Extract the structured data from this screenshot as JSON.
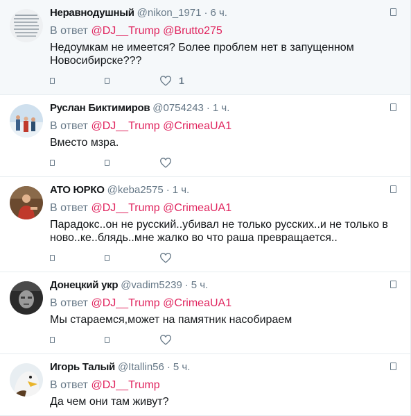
{
  "colors": {
    "mention": "#e0245e",
    "secondary": "#657786",
    "text": "#14171a",
    "divider": "#e6ecf0",
    "highlight_bg": "#f5f8fa"
  },
  "tweets": [
    {
      "name": "Неравнодушный",
      "handle": "@nikon_1971",
      "time": "6 ч.",
      "reply_prefix": "В ответ",
      "mentions": [
        "@DJ__Trump",
        "@Brutto275"
      ],
      "text": "Недоумкам не имеется? Более проблем нет в запущенном Новосибирске???",
      "likes": "1",
      "avatar": "document-thumbnail"
    },
    {
      "name": "Руслан Биктимиров",
      "handle": "@0754243",
      "time": "1 ч.",
      "reply_prefix": "В ответ",
      "mentions": [
        "@DJ__Trump",
        "@CrimeaUA1"
      ],
      "text": "Вместо мзра.",
      "likes": "",
      "avatar": "winter-people-photo"
    },
    {
      "name": "АТО ЮРКО",
      "handle": "@keba2575",
      "time": "1 ч.",
      "reply_prefix": "В ответ",
      "mentions": [
        "@DJ__Trump",
        "@CrimeaUA1"
      ],
      "text": "Парадокс..он не русский..убивал не только русских..и не только в ново..ке..блядь..мне жалко во что раша превращается..",
      "likes": "",
      "avatar": "person-red-photo"
    },
    {
      "name": "Донецкий укр",
      "handle": "@vadim5239",
      "time": "5 ч.",
      "reply_prefix": "В ответ",
      "mentions": [
        "@DJ__Trump",
        "@CrimeaUA1"
      ],
      "text": "Мы стараемся,может на памятник насобираем",
      "likes": "",
      "avatar": "bw-face-photo"
    },
    {
      "name": "Игорь Талый",
      "handle": "@Itallin56",
      "time": "5 ч.",
      "reply_prefix": "В ответ",
      "mentions": [
        "@DJ__Trump"
      ],
      "text": "Да чем они там живут?",
      "likes": "",
      "avatar": "eagle-photo"
    }
  ]
}
